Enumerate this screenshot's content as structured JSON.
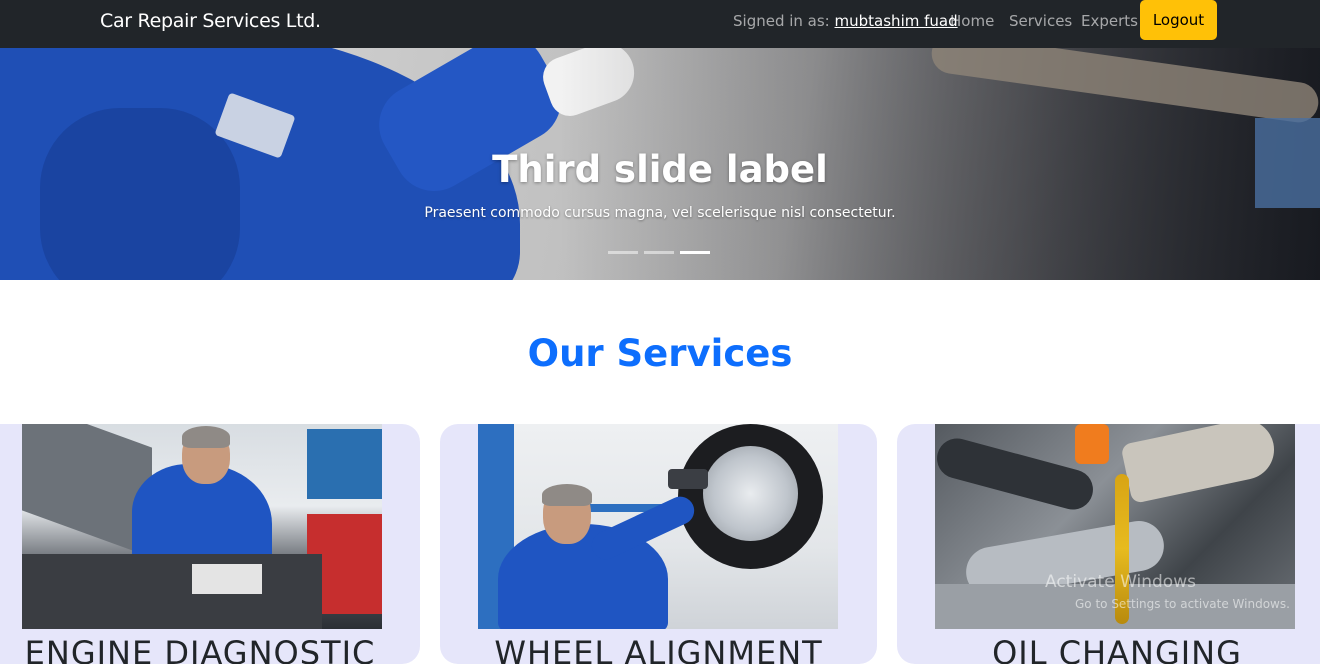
{
  "navbar": {
    "brand": "Car Repair Services Ltd.",
    "signed_in_label": "Signed in as:",
    "user_name": "mubtashim fuad",
    "links": [
      "Home",
      "Services",
      "Experts"
    ],
    "logout_label": "Logout",
    "accent_color": "#ffc107",
    "background_color": "#212529"
  },
  "hero": {
    "title": "Third slide label",
    "caption": "Praesent commodo cursus magna, vel scelerisque nisl consectetur.",
    "slide_count": 3,
    "active_slide": 3
  },
  "services": {
    "heading": "Our Services",
    "heading_color": "#0d6efd",
    "card_color": "#e6e6fa",
    "cards": [
      {
        "title": "ENGINE DIAGNOSTIC",
        "image": "mechanic-engine-image"
      },
      {
        "title": "WHEEL ALIGNMENT",
        "image": "mechanic-wheel-image"
      },
      {
        "title": "OIL CHANGING",
        "image": "oil-pouring-image"
      }
    ]
  },
  "watermark": {
    "line1": "Activate Windows",
    "line2": "Go to Settings to activate Windows."
  }
}
